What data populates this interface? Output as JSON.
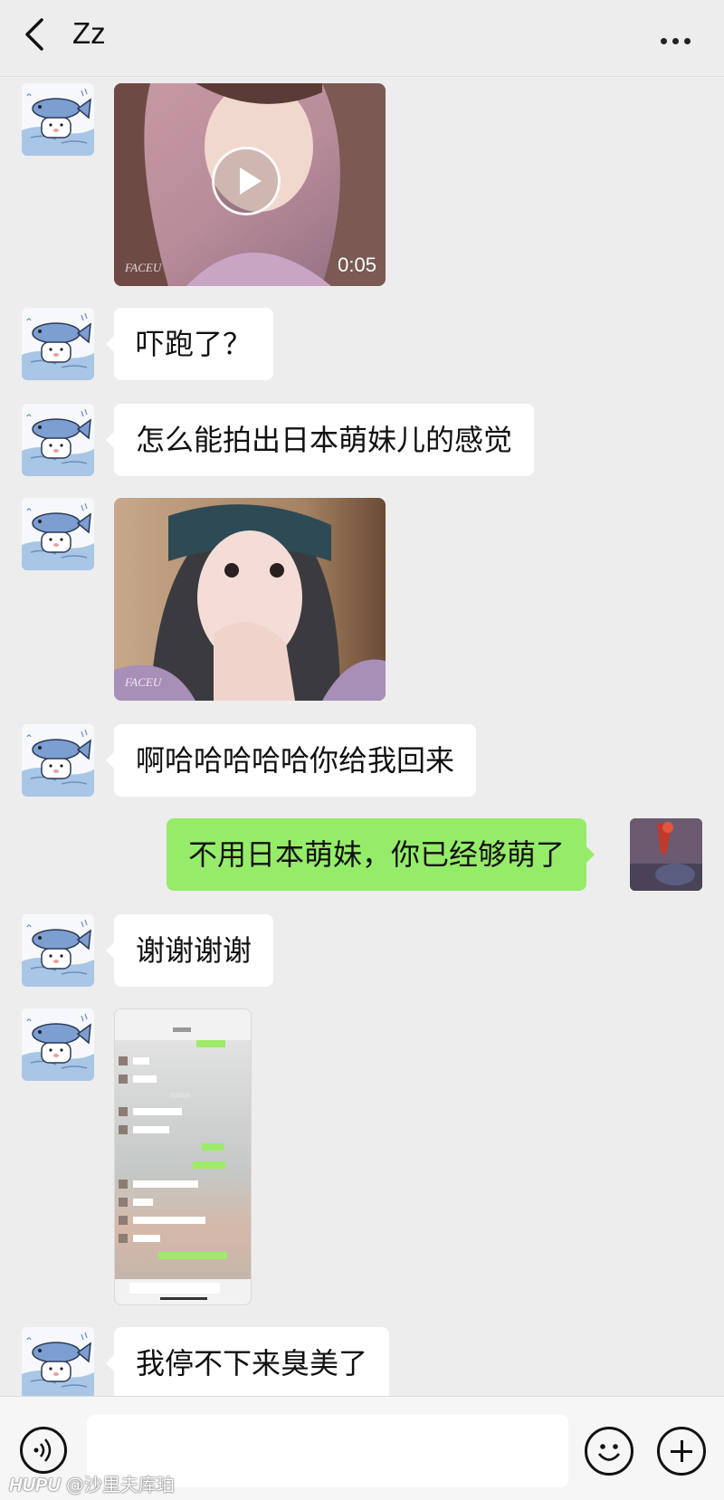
{
  "header": {
    "title": "Zz",
    "back_icon": "chevron-left-icon",
    "more_icon": "more-dots-icon"
  },
  "messages": [
    {
      "from": "them",
      "type": "video",
      "duration": "0:05",
      "watermark": "FACEU"
    },
    {
      "from": "them",
      "type": "text",
      "text": "吓跑了？"
    },
    {
      "from": "them",
      "type": "text",
      "text": "怎么能拍出日本萌妹儿的感觉"
    },
    {
      "from": "them",
      "type": "image",
      "watermark": "FACEU"
    },
    {
      "from": "them",
      "type": "text",
      "text": "啊哈哈哈哈哈你给我回来"
    },
    {
      "from": "me",
      "type": "text",
      "text": "不用日本萌妹，你已经够萌了"
    },
    {
      "from": "them",
      "type": "text",
      "text": "谢谢谢谢"
    },
    {
      "from": "them",
      "type": "image",
      "description": "chat-screenshot"
    },
    {
      "from": "them",
      "type": "text",
      "text": "我停不下来臭美了"
    }
  ],
  "input_bar": {
    "voice_icon": "voice-icon",
    "emoji_icon": "emoji-icon",
    "plus_icon": "plus-icon",
    "placeholder": ""
  },
  "watermark": {
    "brand": "HUPU",
    "handle": "@沙里夫库珀"
  },
  "colors": {
    "background": "#ededed",
    "bubble_me": "#95ec69",
    "bubble_them": "#ffffff"
  }
}
